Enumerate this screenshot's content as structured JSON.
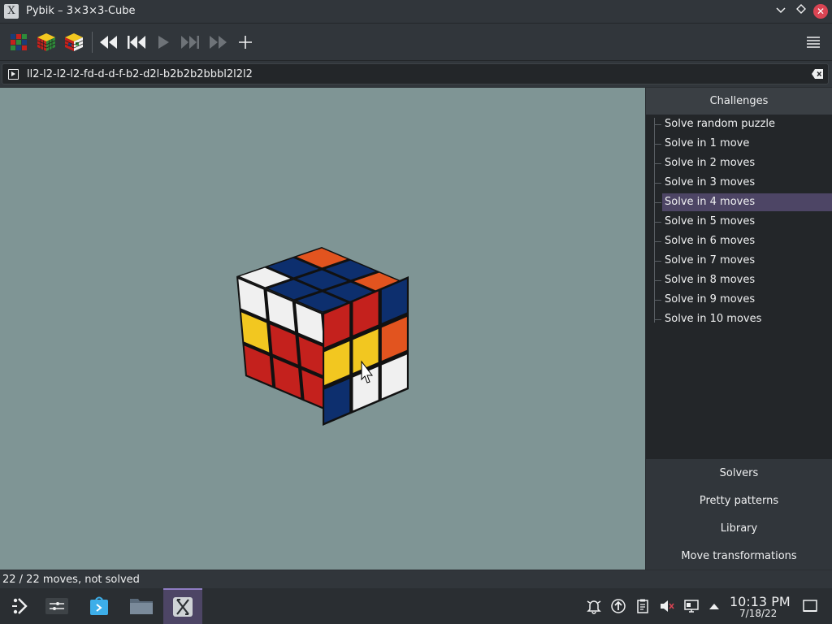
{
  "window": {
    "title": "Pybik – 3×3×3-Cube",
    "app_icon_glyph": "X"
  },
  "toolbar": {
    "items": [
      "new-random-cube",
      "new-solved-cube",
      "edit-cube",
      "rewind",
      "previous",
      "play",
      "next",
      "forward",
      "add-mark"
    ],
    "menu_icon": "hamburger-menu-icon"
  },
  "movebar": {
    "value": "ll2-l2-l2-l2-fd-d-d-f-b2-d2l-b2b2b2bbbl2l2l2"
  },
  "sidebar": {
    "header": "Challenges",
    "items": [
      "Solve random puzzle",
      "Solve in 1 move",
      "Solve in 2 moves",
      "Solve in 3 moves",
      "Solve in 4 moves",
      "Solve in 5 moves",
      "Solve in 6 moves",
      "Solve in 7 moves",
      "Solve in 8 moves",
      "Solve in 9 moves",
      "Solve in 10 moves"
    ],
    "selected_index": 4,
    "sections": [
      "Solvers",
      "Pretty patterns",
      "Library",
      "Move transformations"
    ]
  },
  "status": {
    "text": "22 / 22 moves, not solved"
  },
  "cube": {
    "top": [
      "#f0f0f0",
      "#0d2f6e",
      "#e2541f",
      "#0d2f6e",
      "#0d2f6e",
      "#0d2f6e",
      "#0d2f6e",
      "#0d2f6e",
      "#e2541f"
    ],
    "left": [
      "#f0f0f0",
      "#f0f0f0",
      "#f0f0f0",
      "#f2c720",
      "#c4211d",
      "#c4211d",
      "#c4211d",
      "#c4211d",
      "#c4211d"
    ],
    "right": [
      "#c4211d",
      "#c4211d",
      "#0d2f6e",
      "#f2c720",
      "#f2c720",
      "#e2541f",
      "#0d2f6e",
      "#f0f0f0",
      "#f0f0f0"
    ]
  },
  "taskbar": {
    "apps": [
      "application-launcher-icon",
      "system-settings-icon",
      "discover-store-icon",
      "file-manager-icon",
      "pybik-app-icon"
    ],
    "active_index": 4,
    "tray": [
      "notifications-icon",
      "updates-icon",
      "clipboard-icon",
      "volume-muted-icon",
      "network-icon",
      "show-hidden-icon"
    ],
    "time": "10:13 PM",
    "date": "7/18/22"
  },
  "colors": {
    "viewport_bg": "#7f9595",
    "accent": "#4d4565"
  }
}
